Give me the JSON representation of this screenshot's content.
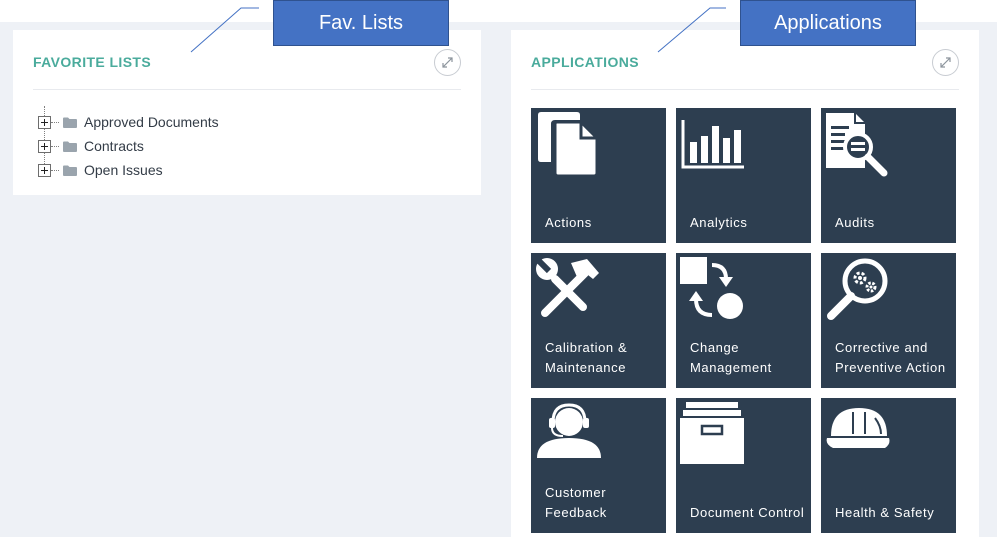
{
  "favorites": {
    "title": "FAVORITE LISTS",
    "items": [
      {
        "label": "Approved Documents"
      },
      {
        "label": "Contracts"
      },
      {
        "label": "Open Issues"
      }
    ]
  },
  "applications": {
    "title": "APPLICATIONS",
    "tiles": [
      {
        "label": "Actions",
        "icon": "documents-icon"
      },
      {
        "label": "Analytics",
        "icon": "bar-chart-icon"
      },
      {
        "label": "Audits",
        "icon": "document-magnifier-icon"
      },
      {
        "label": "Calibration & Maintenance",
        "icon": "tools-icon"
      },
      {
        "label": "Change Management",
        "icon": "change-arrows-icon"
      },
      {
        "label": "Corrective and Preventive Action",
        "icon": "gear-magnifier-icon"
      },
      {
        "label": "Customer Feedback",
        "icon": "headset-user-icon"
      },
      {
        "label": "Document Control",
        "icon": "file-box-icon"
      },
      {
        "label": "Health & Safety",
        "icon": "hard-hat-icon"
      }
    ]
  },
  "callouts": {
    "fav": "Fav. Lists",
    "apps": "Applications"
  },
  "colors": {
    "background": "#eef1f6",
    "accent": "#4aab9c",
    "tile": "#2d3e50",
    "callout": "#4472c4"
  }
}
